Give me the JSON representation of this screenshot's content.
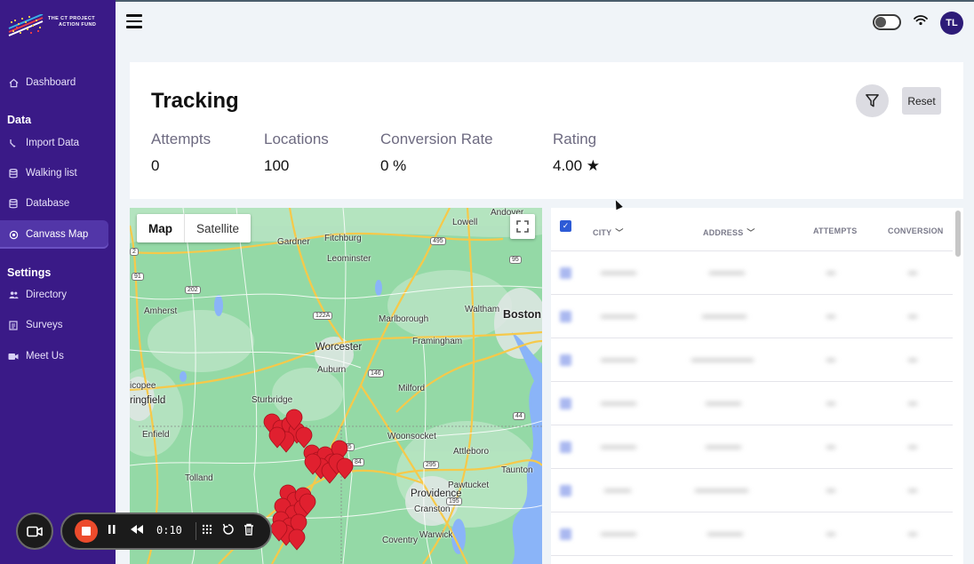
{
  "logo": {
    "line1": "THE CT PROJECT",
    "line2": "ACTION FUND"
  },
  "sidebar": {
    "items": [
      {
        "label": "Dashboard",
        "icon": "home-icon"
      },
      {
        "label": "Import Data",
        "icon": "import-icon"
      },
      {
        "label": "Walking list",
        "icon": "database-icon"
      },
      {
        "label": "Database",
        "icon": "database-icon"
      },
      {
        "label": "Canvass Map",
        "icon": "target-icon"
      },
      {
        "label": "Directory",
        "icon": "people-icon"
      },
      {
        "label": "Surveys",
        "icon": "survey-icon"
      },
      {
        "label": "Meet Us",
        "icon": "video-icon"
      }
    ],
    "sections": {
      "data": "Data",
      "settings": "Settings"
    },
    "active": "Canvass Map"
  },
  "topbar": {
    "avatar_initials": "TL"
  },
  "tracking": {
    "title": "Tracking",
    "stats": [
      {
        "label": "Attempts",
        "value": "0"
      },
      {
        "label": "Locations",
        "value": "100"
      },
      {
        "label": "Conversion Rate",
        "value": "0 %"
      },
      {
        "label": "Rating",
        "value": "4.00 ★"
      }
    ],
    "reset_label": "Reset"
  },
  "map": {
    "tab_map": "Map",
    "tab_satellite": "Satellite",
    "places": [
      "Andover",
      "Lowell",
      "Gardner",
      "Fitchburg",
      "Leominster",
      "Amherst",
      "Marlborough",
      "Waltham",
      "Boston",
      "Worcester",
      "Framingham",
      "Auburn",
      "Milford",
      "Sturbridge",
      "Woonsocket",
      "Enfield",
      "Attleboro",
      "Taunton",
      "Tolland",
      "Pawtucket",
      "Providence",
      "Cranston",
      "Warwick",
      "Coventry",
      "ringfield",
      "icopee"
    ],
    "shields": [
      "202",
      "2",
      "495",
      "95",
      "91",
      "122A",
      "146",
      "395",
      "84",
      "44",
      "295",
      "195"
    ]
  },
  "table": {
    "columns": [
      "CITY",
      "ADDRESS",
      "ATTEMPTS",
      "CONVERSION"
    ],
    "rows": 7
  },
  "recorder": {
    "time": "0:10"
  },
  "colors": {
    "sidebar": "#3a1a87",
    "accent": "#2d5bd6",
    "marker": "#e0202f",
    "record": "#ec4b2c"
  }
}
